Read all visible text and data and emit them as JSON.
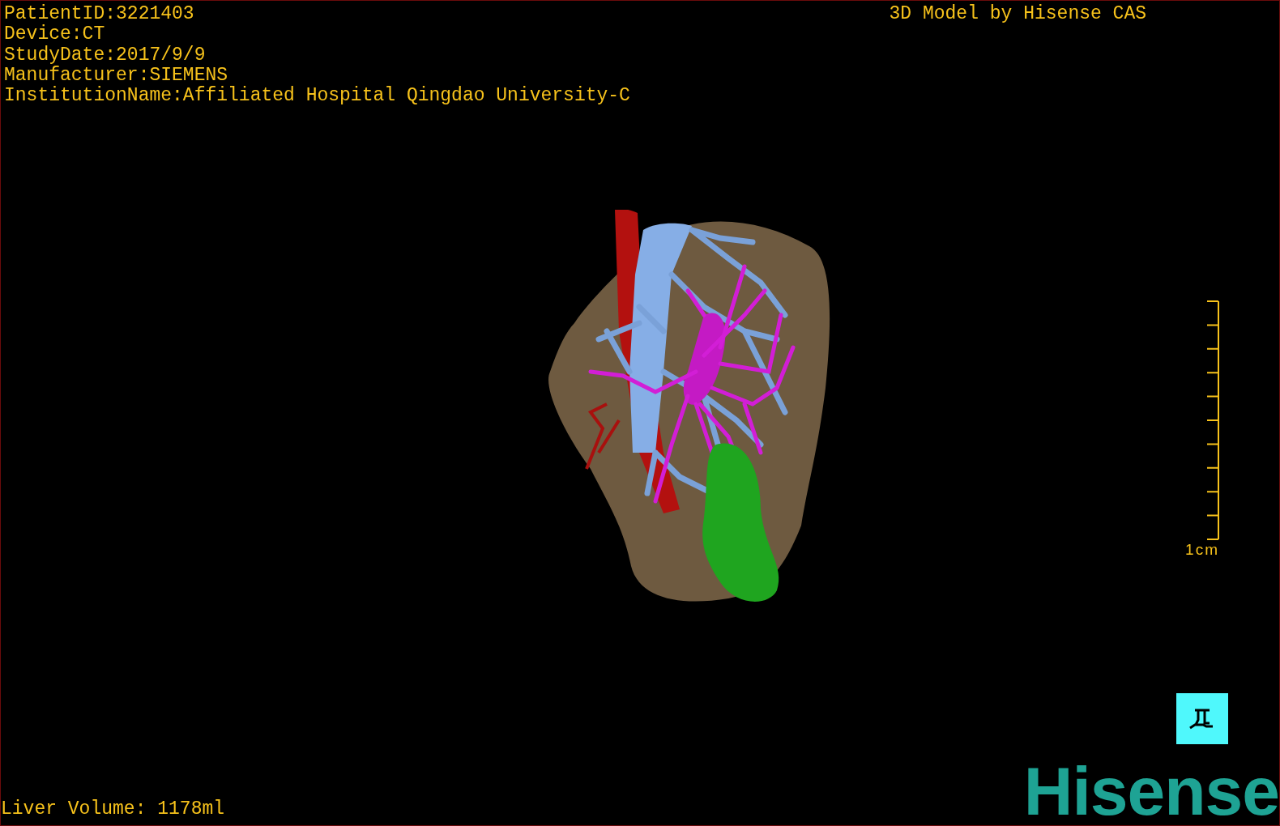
{
  "viewer": {
    "patient_info": [
      "PatientID:3221403",
      "Device:CT",
      "StudyDate:2017/9/9",
      "Manufacturer:SIEMENS",
      "InstitutionName:Affiliated Hospital Qingdao University-C"
    ],
    "credit": "3D Model by Hisense CAS",
    "scale_label": "1cm",
    "liver_volume": "Liver Volume: 1178ml",
    "logo": "Hisense"
  }
}
